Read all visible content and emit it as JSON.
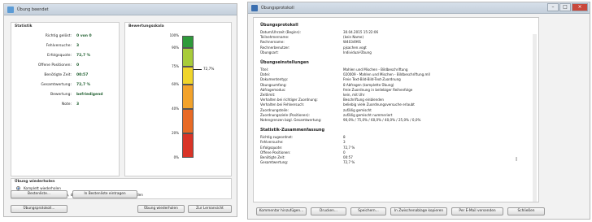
{
  "left": {
    "title": "Übung beendet",
    "statistik_label": "Statistik",
    "bewertung_label": "Bewertungsskala",
    "stats": [
      {
        "label": "Richtig gelöst:",
        "value": "0 von 0"
      },
      {
        "label": "Fehlversuche:",
        "value": "3"
      },
      {
        "label": "Erfolgsquote:",
        "value": "72,7 %"
      },
      {
        "label": "Offene Positionen:",
        "value": "0"
      },
      {
        "label": "Benötigte Zeit:",
        "value": "00:57"
      },
      {
        "label": "Gesamtwertung:",
        "value": "72,7 %"
      },
      {
        "label": "Bewertung:",
        "value": "befriedigend"
      },
      {
        "label": "Note:",
        "value": "3"
      }
    ],
    "scale": {
      "ticks": [
        "100%",
        "90%",
        "75%",
        "60%",
        "40%",
        "20%",
        "0%"
      ],
      "marker_label": "72,7%",
      "marker_value": 72.7,
      "bands": [
        {
          "from": 90,
          "to": 100,
          "color": "#2e9a3a"
        },
        {
          "from": 75,
          "to": 90,
          "color": "#a8cc3a"
        },
        {
          "from": 60,
          "to": 75,
          "color": "#f0d52a"
        },
        {
          "from": 40,
          "to": 60,
          "color": "#f2a22a"
        },
        {
          "from": 20,
          "to": 40,
          "color": "#e86a25"
        },
        {
          "from": 0,
          "to": 20,
          "color": "#d93427"
        }
      ]
    },
    "repeat_label": "Übung wiederholen",
    "radio1": "Komplett wiederholen",
    "radio2": "Nur Abfragen wiederholen, die nicht auf Anhieb korrekt gelöst wurden",
    "btn_bestenliste": "Bestenliste...",
    "btn_eintragen": "In Bestenliste eintragen",
    "btn_protokoll": "Übungsprotokoll...",
    "btn_wiederholen": "Übung wiederholen",
    "btn_lernansicht": "Zur Lernansicht"
  },
  "right": {
    "title": "Übungsprotokoll",
    "sec1": "Übungsprotokoll",
    "rows1": [
      {
        "k": "Datum/Uhrzeit (Beginn):",
        "v": "30.04.2015 15:22:06"
      },
      {
        "k": "Teilnehmername:",
        "v": "(kein Name)"
      },
      {
        "k": "Rechnername:",
        "v": "W4034991"
      },
      {
        "k": "Rechnerbenutzer:",
        "v": "pjsachen.vogt"
      },
      {
        "k": "Übungsart:",
        "v": "Individual-Übung"
      }
    ],
    "sec2": "Übungseinstellungen",
    "rows2": [
      {
        "k": "Titel:",
        "v": "Mahlen und Mischen - Bildbeschriftung"
      },
      {
        "k": "Datei:",
        "v": "020009 - Mahlen und Mischen - Bildbeschriftung.mll"
      },
      {
        "k": "Dokumententyp:",
        "v": "Freie Text-Bild-Bild-Text-Zuordnung"
      },
      {
        "k": "Übungsumfang:",
        "v": "8 Abfragen (komplette Übung)"
      },
      {
        "k": "Abfragemodus:",
        "v": "freie Zuordnung in beliebiger Reihenfolge"
      },
      {
        "k": "Zeitlimit:",
        "v": "kein, mit Uhr"
      },
      {
        "k": "Verhalten bei richtiger Zuordnung:",
        "v": "Beschriftung einblenden"
      },
      {
        "k": "Verhalten bei Fehlversuch:",
        "v": "beliebig viele Zuordnungsversuche erlaubt"
      },
      {
        "k": "Zuordnungsteile:",
        "v": "zufällig gemischt"
      },
      {
        "k": "Zuordnungsziele (Positionen):",
        "v": "zufällig gemischt nummeriert"
      },
      {
        "k": "Notengrenzen bzgl. Gesamtwertung:",
        "v": "90,0% / 75,0% / 60,0% / 40,0% / 25,0% / 0,0%"
      }
    ],
    "sec3": "Statistik-Zusammenfassung",
    "rows3": [
      {
        "k": "Richtig zugeordnet:",
        "v": "8"
      },
      {
        "k": "Fehlversuche:",
        "v": "3"
      },
      {
        "k": "Erfolgsquote:",
        "v": "72,7 %"
      },
      {
        "k": "Offene Positionen:",
        "v": "0"
      },
      {
        "k": "Benötigte Zeit:",
        "v": "00:57"
      },
      {
        "k": "Gesamtwertung:",
        "v": "72,7 %"
      }
    ],
    "buttons": [
      "Kommentar hinzufügen...",
      "Drucken...",
      "Speichern...",
      "In Zwischenablage kopieren",
      "Per E-Mail versenden",
      "Schließen"
    ]
  }
}
